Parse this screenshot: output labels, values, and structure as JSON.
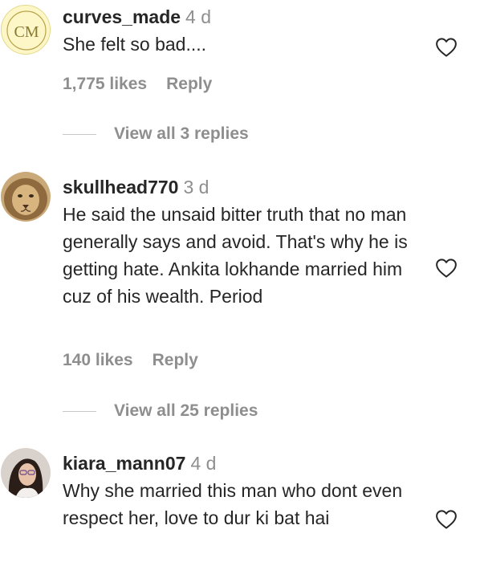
{
  "comments": [
    {
      "username": "curves_made",
      "time": "4 d",
      "text": "She felt so bad....",
      "likes": "1,775 likes",
      "reply_label": "Reply",
      "view_replies": "View all 3 replies",
      "avatar_text": "CM",
      "avatar_icon": "logo-avatar"
    },
    {
      "username": "skullhead770",
      "time": "3 d",
      "text": "He said the unsaid bitter truth that no man generally says and avoid. That's why he is getting hate. Ankita lokhande married him cuz of his wealth. Period",
      "likes": "140 likes",
      "reply_label": "Reply",
      "view_replies": "View all 25 replies",
      "avatar_icon": "lion-avatar"
    },
    {
      "username": "kiara_mann07",
      "time": "4 d",
      "text": "Why she married this man who dont even respect her, love to dur ki bat hai",
      "avatar_icon": "person-avatar"
    }
  ],
  "icons": {
    "like": "heart-outline-icon"
  },
  "colors": {
    "text": "#262626",
    "secondary": "#8e8e8e",
    "divider": "#c7c7c7",
    "avatar_logo_bg": "#fdf6c6"
  }
}
